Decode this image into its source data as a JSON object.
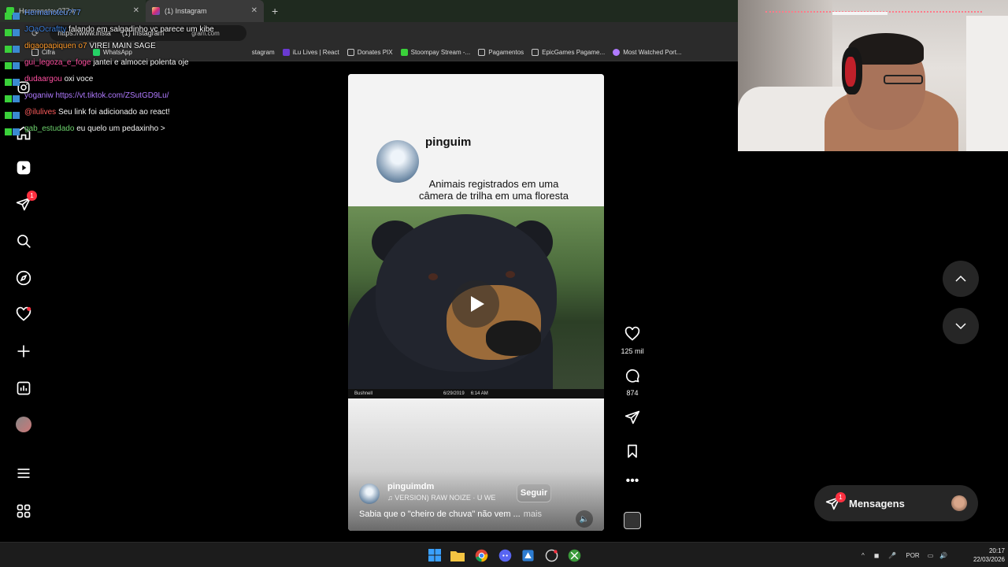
{
  "browser": {
    "tabs": [
      {
        "label": "Hermanoteu?77 k"
      },
      {
        "label": "(1) Instagram"
      }
    ],
    "new_tab_label": "+",
    "address": "https://www.insta",
    "address_suffix": "(1) Instagram",
    "address_domain": "gram.com",
    "bookmarks": [
      {
        "label": "Cifra"
      },
      {
        "label": "WhatsApp"
      },
      {
        "label": "stagram"
      },
      {
        "label": "iLu Lives | React"
      },
      {
        "label": "Donates PIX"
      },
      {
        "label": "Stoompay Stream -..."
      },
      {
        "label": "Pagamentos"
      },
      {
        "label": "EpicGames Pagame..."
      },
      {
        "label": "Most Watched Port..."
      }
    ]
  },
  "chat": [
    {
      "user": "Hermanoteu?77",
      "color": "#6aa0ff",
      "message": ""
    },
    {
      "user": "JOaOcraftty",
      "color": "#3a7bd5",
      "message": "falando em salgadinho vc parece um kibe"
    },
    {
      "user": "digaopapiquen o7",
      "color": "#ff9a2a",
      "message": "VIREI MAIN SAGE"
    },
    {
      "user": "gui_legoza_e_foge",
      "color": "#ff4fa0",
      "message": "jantei e almocei polenta oje"
    },
    {
      "user": "dudaargou",
      "color": "#ff4fa0",
      "message": "oxi voce"
    },
    {
      "user": "yoganiw",
      "color": "#b07aff",
      "message": "https://vt.tiktok.com/ZSutGD9Lu/"
    },
    {
      "user": "@ilulives",
      "color": "#ff5c5c",
      "message": "Seu link foi adicionado ao react!"
    },
    {
      "user": "gab_estudado",
      "color": "#6cd16c",
      "message": "eu quelo um pedaxinho >"
    }
  ],
  "sidebar": {
    "notifications_badge": "1"
  },
  "reel": {
    "account": "pinguim",
    "caption_line1": "Animais registrados em uma",
    "caption_line2": "câmera de trilha em uma floresta",
    "cam_brand": "Bushnell",
    "cam_date": "6/29/2019",
    "cam_time": "6:14 AM",
    "author": "pinguimdm",
    "audio": "VERSION)  RAW NOIZE · U WE",
    "follow_label": "Seguir",
    "description": "Sabia que o \"cheiro de chuva\" não vem ...",
    "more_label": "mais",
    "likes": "125 mil",
    "comments": "874"
  },
  "messages": {
    "label": "Mensagens",
    "badge": "1"
  },
  "taskbar": {
    "lang": "POR",
    "time": "20:17",
    "date": "22/03/2026"
  }
}
